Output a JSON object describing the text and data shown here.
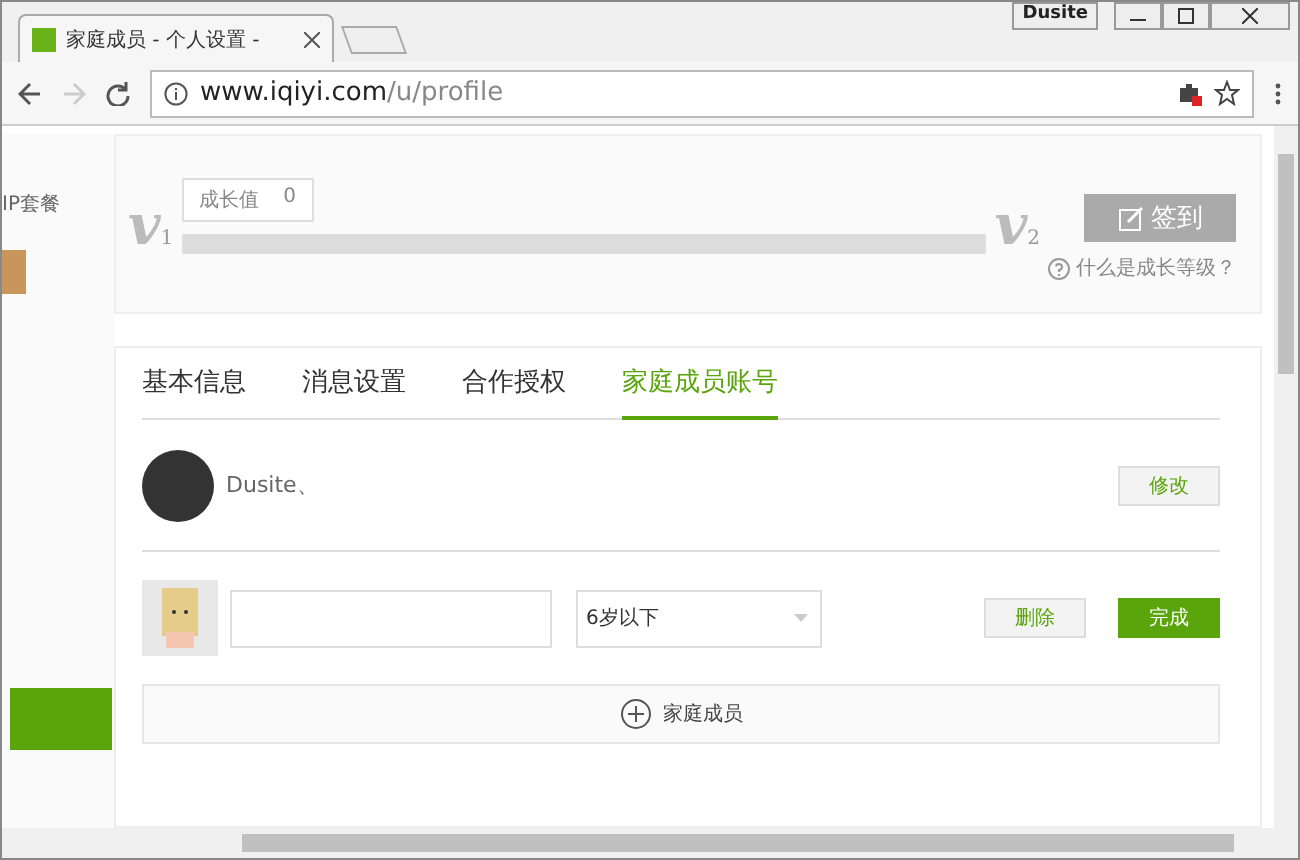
{
  "browser": {
    "profile": "Dusite",
    "tab_title": "家庭成员 - 个人设置 -",
    "url_host": "www.iqiyi.com",
    "url_path": "/u/profile"
  },
  "sidebar": {
    "label": "IP套餐"
  },
  "growth": {
    "value_label": "成长值",
    "value": "0",
    "level_from": "v",
    "level_from_sub": "1",
    "level_to": "v",
    "level_to_sub": "2",
    "level": 0,
    "checkin": "签到",
    "help": "什么是成长等级？"
  },
  "tabs": [
    {
      "label": "基本信息",
      "selected": false
    },
    {
      "label": "消息设置",
      "selected": false
    },
    {
      "label": "合作授权",
      "selected": false
    },
    {
      "label": "家庭成员账号",
      "selected": true
    }
  ],
  "account": {
    "name": "Dusite、",
    "edit": "修改"
  },
  "member": {
    "age": "6岁以下",
    "delete": "删除",
    "done": "完成"
  },
  "add_member": "家庭成员"
}
